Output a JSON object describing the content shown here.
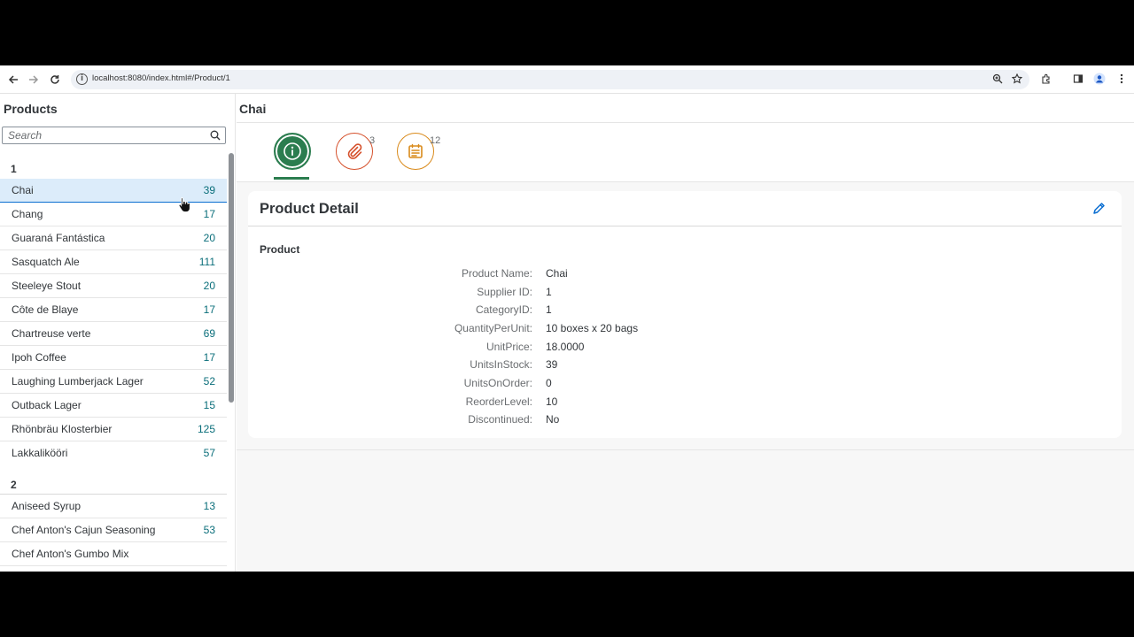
{
  "browser": {
    "url": "localhost:8080/index.html#/Product/1"
  },
  "master": {
    "title": "Products",
    "search_placeholder": "Search",
    "groups": [
      {
        "header": "1",
        "items": [
          {
            "name": "Chai",
            "count": "39"
          },
          {
            "name": "Chang",
            "count": "17"
          },
          {
            "name": "Guaraná Fantástica",
            "count": "20"
          },
          {
            "name": "Sasquatch Ale",
            "count": "111"
          },
          {
            "name": "Steeleye Stout",
            "count": "20"
          },
          {
            "name": "Côte de Blaye",
            "count": "17"
          },
          {
            "name": "Chartreuse verte",
            "count": "69"
          },
          {
            "name": "Ipoh Coffee",
            "count": "17"
          },
          {
            "name": "Laughing Lumberjack Lager",
            "count": "52"
          },
          {
            "name": "Outback Lager",
            "count": "15"
          },
          {
            "name": "Rhönbräu Klosterbier",
            "count": "125"
          },
          {
            "name": "Lakkalikööri",
            "count": "57"
          }
        ]
      },
      {
        "header": "2",
        "items": [
          {
            "name": "Aniseed Syrup",
            "count": "13"
          },
          {
            "name": "Chef Anton's Cajun Seasoning",
            "count": "53"
          },
          {
            "name": "Chef Anton's Gumbo Mix",
            "count": ""
          }
        ]
      }
    ]
  },
  "detail": {
    "title": "Chai",
    "tabs": [
      {
        "icon": "info-icon",
        "count": ""
      },
      {
        "icon": "paperclip-icon",
        "count": "3"
      },
      {
        "icon": "notes-icon",
        "count": "12"
      }
    ],
    "card_title": "Product Detail",
    "section_title": "Product",
    "fields": [
      {
        "label": "Product Name:",
        "value": "Chai"
      },
      {
        "label": "Supplier ID:",
        "value": "1"
      },
      {
        "label": "CategoryID:",
        "value": "1"
      },
      {
        "label": "QuantityPerUnit:",
        "value": "10 boxes x 20 bags"
      },
      {
        "label": "UnitPrice:",
        "value": "18.0000"
      },
      {
        "label": "UnitsInStock:",
        "value": "39"
      },
      {
        "label": "UnitsOnOrder:",
        "value": "0"
      },
      {
        "label": "ReorderLevel:",
        "value": "10"
      },
      {
        "label": "Discontinued:",
        "value": "No"
      }
    ]
  },
  "colors": {
    "selected_row": "#dcecfa",
    "info_tab": "#2b7d4f",
    "attach_tab": "#d5502b",
    "notes_tab": "#d98a1a",
    "count_text": "#0a6e7a"
  }
}
